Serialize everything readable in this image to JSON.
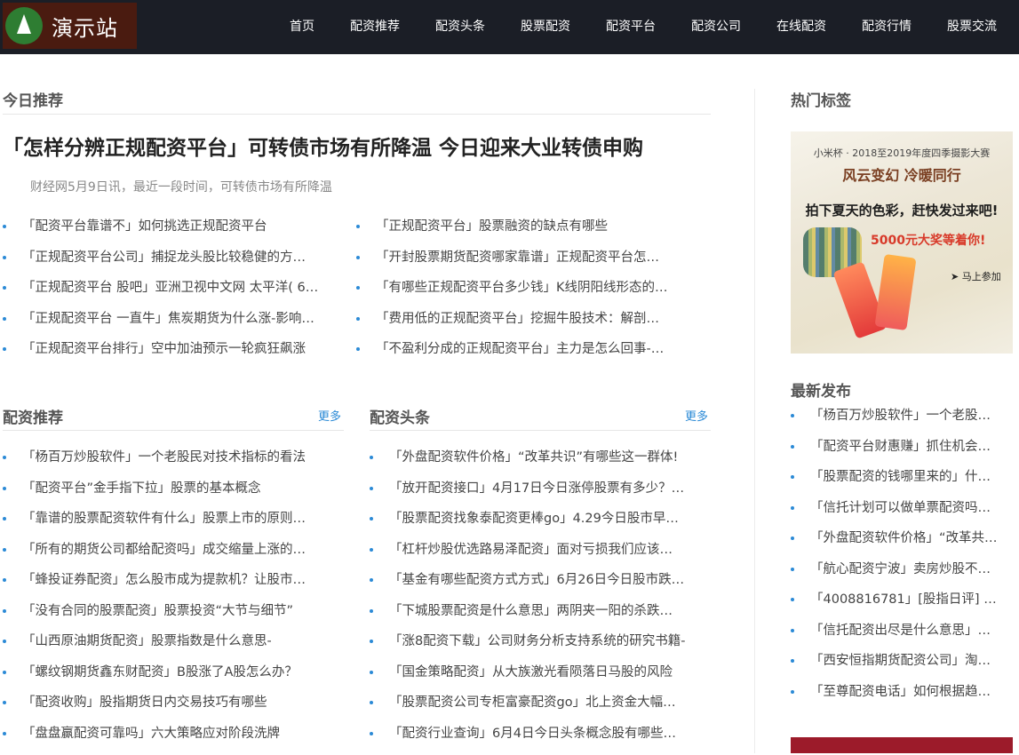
{
  "header": {
    "logo_text": "演示站",
    "nav": [
      "首页",
      "配资推荐",
      "配资头条",
      "股票配资",
      "配资平台",
      "配资公司",
      "在线配资",
      "配资行情",
      "股票交流"
    ]
  },
  "today": {
    "title": "今日推荐",
    "headline": "「怎样分辨正规配资平台」可转债市场有所降温 今日迎来大业转债申购",
    "summary": "财经网5月9日讯，最近一段时间，可转债市场有所降温",
    "left_items": [
      "「配资平台靠谱不」如何挑选正规配资平台",
      "「正规配资平台公司」捕捉龙头股比较稳健的方…",
      "「正规配资平台 股吧」亚洲卫视中文网 太平洋( 6…",
      "「正规配资平台 一直牛」焦炭期货为什么涨-影响…",
      "「正规配资平台排行」空中加油预示一轮疯狂飙涨"
    ],
    "right_items": [
      "「正规配资平台」股票融资的缺点有哪些",
      "「开封股票期货配资哪家靠谱」正规配资平台怎…",
      "「有哪些正规配资平台多少钱」K线阴阳线形态的…",
      "「费用低的正规配资平台」挖掘牛股技术：解剖…",
      "「不盈利分成的正规配资平台」主力是怎么回事-…"
    ]
  },
  "recommend": {
    "title": "配资推荐",
    "more": "更多",
    "items": [
      "「杨百万炒股软件」一个老股民对技术指标的看法",
      "「配资平台”金手指下拉」股票的基本概念",
      "「靠谱的股票配资软件有什么」股票上市的原则…",
      "「所有的期货公司都给配资吗」成交缩量上涨的…",
      "「蜂投证券配资」怎么股市成为提款机？让股市…",
      "「没有合同的股票配资」股票投资“大节与细节”",
      "「山西原油期货配资」股票指数是什么意思-",
      "「螺纹钢期货鑫东财配资」B股涨了A股怎么办？",
      "「配资收购」股指期货日内交易技巧有哪些",
      "「盘盘赢配资可靠吗」六大策略应对阶段洗牌"
    ]
  },
  "headlines": {
    "title": "配资头条",
    "more": "更多",
    "items": [
      "「外盘配资软件价格」“改革共识”有哪些这一群体!",
      "「放开配资接口」4月17日今日涨停股票有多少？…",
      "「股票配资找象泰配资更棒go」4.29今日股市早…",
      "「杠杆炒股优选路易泽配资」面对亏损我们应该…",
      "「基金有哪些配资方式方式」6月26日今日股市跌…",
      "「下城股票配资是什么意思」两阴夹一阳的杀跌…",
      "「涨8配资下载」公司财务分析支持系统的研究书籍-",
      "「国金策略配资」从大族激光看陨落日马股的风险",
      "「股票配资公司专柜富豪配资go」北上资金大幅…",
      "「配资行业查询」6月4日今日头条概念股有哪些…"
    ]
  },
  "sidebar": {
    "tags_title": "热门标签",
    "ad": {
      "line1": "小米杯 · 2018至2019年度四季摄影大赛",
      "line2": "风云变幻  冷暖同行",
      "line3": "拍下夏天的色彩，赶快发过来吧!",
      "line4": "5000元大奖等着你!",
      "join": "马上参加"
    },
    "latest_title": "最新发布",
    "latest_items": [
      "「杨百万炒股软件」一个老股…",
      "「配资平台财惠赚」抓住机会…",
      "「股票配资的钱哪里来的」什…",
      "「信托计划可以做单票配资吗…",
      "「外盘配资软件价格」“改革共…",
      "「航心配资宁波」卖房炒股不…",
      "「4008816781」[股指日评] 关…",
      "「信托配资出尽是什么意思」…",
      "「西安恒指期货配资公司」淘…",
      "「至尊配资电话」如何根据趋…"
    ]
  },
  "colors": {
    "header_bg": "#1b1e26",
    "accent": "#2b8ad6",
    "logo_bg": "#4a1b10"
  }
}
